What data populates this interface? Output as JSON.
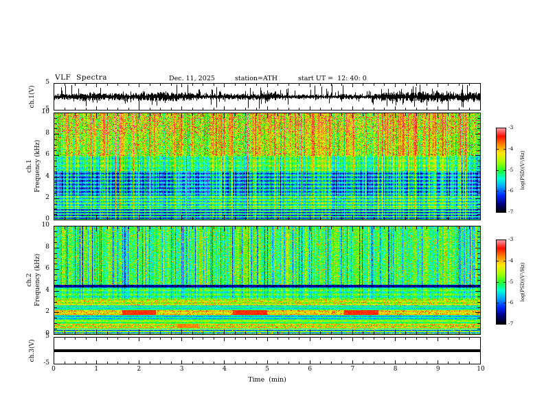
{
  "header": {
    "title": "VLF  Spectra",
    "date": "Dec. 11, 2025",
    "station": "station=ATH",
    "start_ut": "start UT =  12: 40: 0"
  },
  "xaxis": {
    "label": "Time  (min)",
    "range": [
      0,
      10
    ],
    "ticks": [
      0,
      1,
      2,
      3,
      4,
      5,
      6,
      7,
      8,
      9,
      10
    ]
  },
  "colorbar": {
    "label": "log(PSD)(V²/Hz)",
    "range": [
      -7,
      -3
    ],
    "ticks": [
      -3,
      -4,
      -5,
      -6,
      -7
    ],
    "gradient": [
      "#000000",
      "#000080",
      "#0028ff",
      "#00a0ff",
      "#00ffd8",
      "#28ff28",
      "#a8ff00",
      "#ffe800",
      "#ff8800",
      "#ff1000",
      "#ff9ca8"
    ]
  },
  "chart_data": [
    {
      "id": "ch1_waveform",
      "type": "line",
      "ylabel": "ch.1(V)",
      "ylim": [
        -5,
        5
      ],
      "ytick_labels": [
        5,
        -5
      ],
      "x_range_min": [
        0,
        10
      ],
      "signal_summary": "broadband noise of about ±1 V with dense impulsive sferic spikes reaching ±5 V throughout the 10 minutes"
    },
    {
      "id": "ch1_spectrogram",
      "type": "heatmap",
      "row_label": "ch.1",
      "ylabel": "Frequency (kHz)",
      "ylim": [
        0,
        10
      ],
      "yticks": [
        0,
        2,
        4,
        6,
        8,
        10
      ],
      "value_units": "log(PSD) (V²/Hz)",
      "value_range": [
        -7,
        -3
      ],
      "summary": "green/yellow speckled field with dense red vertical sferic streaks above ~6 kHz, a dark-blue striated band from ~2.3 to 4.6 kHz, and layered horizontal banding below ~2.3 kHz",
      "streaks": {
        "type": "bright",
        "bright_density": 0.45,
        "dark_density": 0.25,
        "full_column_rate": 0.03
      },
      "bands": [
        {
          "f": [
            8,
            10
          ],
          "level": -4.7,
          "noise": 0.45,
          "speckle_p": 0.2,
          "speckle_level": -3.25,
          "streak_gain": 1.4,
          "col_mod": 0.3
        },
        {
          "f": [
            6,
            8
          ],
          "level": -4.8,
          "noise": 0.45,
          "speckle_p": 0.1,
          "speckle_level": -3.4,
          "streak_gain": 1.35,
          "col_mod": 0.3
        },
        {
          "f": [
            4.6,
            6
          ],
          "level": -5.2,
          "noise": 0.35,
          "stripe_amp": 0.2,
          "stripe_period": 0.45,
          "streak_gain": 1.0,
          "col_mod": 0.5
        },
        {
          "f": [
            2.3,
            4.6
          ],
          "level": -5.85,
          "noise": 0.3,
          "stripe_amp": 0.45,
          "stripe_period": 0.34,
          "streak_gain": 0.9,
          "dark_gain": 0.35,
          "col_mod": 0.5
        },
        {
          "f": [
            1.15,
            2.3
          ],
          "level": -5.35,
          "noise": 0.3,
          "stripe_amp": 0.5,
          "stripe_period": 0.3,
          "streak_gain": 0.7,
          "col_mod": 0.4
        },
        {
          "f": [
            0,
            1.15
          ],
          "level": -5.7,
          "noise": 0.25,
          "stripe_amp": 0.8,
          "stripe_period": 0.26,
          "streak_gain": 0.5,
          "col_mod": 0.3
        }
      ]
    },
    {
      "id": "ch2_spectrogram",
      "type": "heatmap",
      "row_label": "ch.2",
      "ylabel": "Frequency (kHz)",
      "ylim": [
        0,
        10
      ],
      "yticks": [
        0,
        2,
        4,
        6,
        8,
        10
      ],
      "value_units": "log(PSD) (V²/Hz)",
      "value_range": [
        -7,
        -3
      ],
      "summary": "mostly green field with thin dark-blue vertical streaks above ~4.6 kHz, a near-black horizontal line at ~4.5 kHz, and yellow/orange horizontal bands near 0.8, 2.0 and 3.0 kHz with intermittent red-hot segments near 2 kHz",
      "streaks": {
        "type": "dark",
        "bright_density": 0.12,
        "dark_density": 0.4,
        "full_column_rate": 0
      },
      "bands": [
        {
          "f": [
            4.6,
            10
          ],
          "level": -4.95,
          "noise": 0.4,
          "dark_gain": 1.15,
          "streak_gain": 0.25,
          "speckle_p": 0.05,
          "speckle_level": -3.9,
          "col_mod": 0.35
        },
        {
          "f": [
            4.35,
            4.6
          ],
          "level": -6.5,
          "noise": 0.25,
          "dark_gain": 0.3
        },
        {
          "f": [
            3.25,
            4.35
          ],
          "level": -5.05,
          "noise": 0.3,
          "stripe_amp": 0.3,
          "stripe_period": 0.4,
          "dark_gain": 0.45,
          "col_mod": 0.3
        },
        {
          "f": [
            2.7,
            3.25
          ],
          "level": -4.65,
          "noise": 0.3,
          "speckle_p": 0.22,
          "speckle_level": -3.8,
          "stripe_amp": 0.2,
          "stripe_period": 0.3
        },
        {
          "f": [
            2.25,
            2.7
          ],
          "level": -5.35,
          "noise": 0.25,
          "stripe_amp": 0.3,
          "stripe_period": 0.25
        },
        {
          "f": [
            1.8,
            2.25
          ],
          "level": -4.25,
          "noise": 0.3,
          "speckle_p": 0.15,
          "speckle_level": -3.6,
          "stripe_amp": 0.25,
          "stripe_period": 0.3
        },
        {
          "f": [
            1.45,
            1.8
          ],
          "level": -5.5,
          "noise": 0.25,
          "stripe_amp": 0.35,
          "stripe_period": 0.22
        },
        {
          "f": [
            1.0,
            1.45
          ],
          "level": -4.85,
          "noise": 0.3,
          "stripe_amp": 0.3,
          "stripe_period": 0.3
        },
        {
          "f": [
            0.6,
            1.0
          ],
          "level": -4.45,
          "noise": 0.3,
          "speckle_p": 0.18,
          "speckle_level": -3.7,
          "stripe_amp": 0.45,
          "stripe_period": 0.3
        },
        {
          "f": [
            0,
            0.6
          ],
          "level": -5.25,
          "noise": 0.25,
          "stripe_amp": 0.9,
          "stripe_period": 0.24,
          "speckle_p": 0.05,
          "speckle_level": -4.0
        }
      ],
      "hot_segments": [
        {
          "f": [
            1.8,
            2.25
          ],
          "x": [
            1.6,
            2.4
          ],
          "level": -3.5
        },
        {
          "f": [
            1.8,
            2.25
          ],
          "x": [
            4.2,
            5.0
          ],
          "level": -3.5
        },
        {
          "f": [
            1.8,
            2.25
          ],
          "x": [
            6.8,
            7.6
          ],
          "level": -3.5
        },
        {
          "f": [
            0.6,
            1.0
          ],
          "x": [
            2.9,
            3.4
          ],
          "level": -3.8
        }
      ]
    },
    {
      "id": "ch3_waveform",
      "type": "line",
      "ylabel": "ch.3(V)",
      "ylim": [
        -5,
        5
      ],
      "ytick_labels": [
        5,
        -5
      ],
      "x_range_min": [
        0,
        10
      ],
      "signal_summary": "constant flat line at 0 V (channel inactive)"
    }
  ]
}
